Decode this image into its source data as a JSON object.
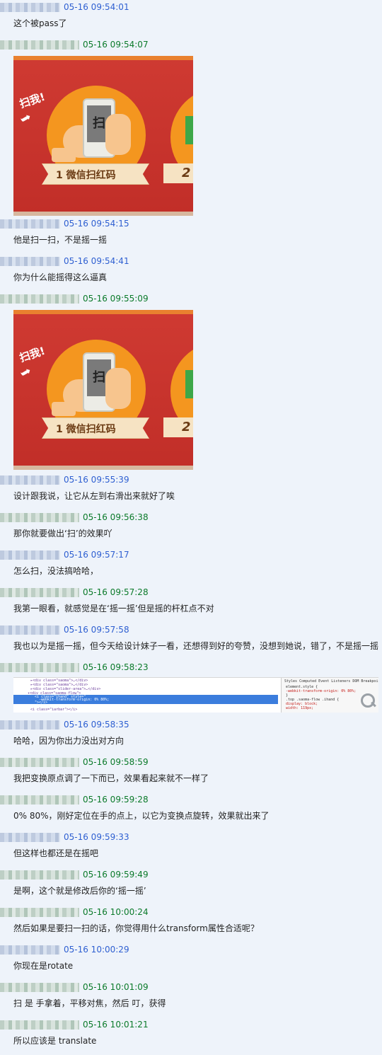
{
  "messages": [
    {
      "time": "05-16 09:54:01",
      "side": "blue",
      "text": "这个被pass了"
    },
    {
      "time": "05-16 09:54:07",
      "side": "green",
      "image": "promo",
      "promo": {
        "scan": "扫我!",
        "screen": "扫",
        "step1": "1 微信扫红码",
        "step2": "2"
      }
    },
    {
      "time": "05-16 09:54:15",
      "side": "blue",
      "text": "他是扫一扫，不是摇一摇"
    },
    {
      "time": "05-16 09:54:41",
      "side": "blue",
      "text": "你为什么能摇得这么逼真"
    },
    {
      "time": "05-16 09:55:09",
      "side": "green",
      "image": "promo",
      "promo": {
        "scan": "扫我!",
        "screen": "扫",
        "step1": "1 微信扫红码",
        "step2": "2"
      }
    },
    {
      "time": "05-16 09:55:39",
      "side": "blue",
      "text": "设计跟我说，让它从左到右滑出来就好了唉"
    },
    {
      "time": "05-16 09:56:38",
      "side": "green",
      "text": "那你就要做出‘扫’的效果吖"
    },
    {
      "time": "05-16 09:57:17",
      "side": "blue",
      "text": "怎么扫，没法搞哈哈，"
    },
    {
      "time": "05-16 09:57:28",
      "side": "green",
      "text": "我第一眼看，就感觉是在‘摇一摇’但是摇的杆杠点不对"
    },
    {
      "time": "05-16 09:57:58",
      "side": "blue",
      "text": "我也以为是摇一摇，但今天给设计妹子一看，还想得到好的夸赞，没想到她说，错了，不是摇一摇"
    },
    {
      "time": "05-16 09:58:23",
      "side": "green",
      "image": "devtools",
      "devtools": {
        "lines": [
          "▸<div class=\"saoma\">…</div>",
          "▸<div class=\"saoma\">…</div>",
          "▸<div class=\"slider-area\">…</div>",
          "▾<div class=\"saoma-flow\">"
        ],
        "selected": [
          "<i class=\"ihand\" style=\"",
          "-webkit-transform-origin: 0% 80%;",
          "\"></i>"
        ],
        "after": "<i class=\"iarbar\"></i>",
        "tabs": "Styles  Computed  Event Listeners  DOM Breakpoints  Pro",
        "rules": [
          "element.style {",
          "-webkit-transform-origin: 0% 80%;",
          "}",
          ".top .saoma-flow .ihand {",
          "display: block;",
          "width: 119px;"
        ]
      }
    },
    {
      "time": "05-16 09:58:35",
      "side": "blue",
      "text": "哈哈，因为你出力没出对方向"
    },
    {
      "time": "05-16 09:58:59",
      "side": "green",
      "text": "我把变换原点调了一下而已，效果看起来就不一样了"
    },
    {
      "time": "05-16 09:59:28",
      "side": "green",
      "text": "0% 80%，刚好定位在手的点上，以它为变换点旋转，效果就出来了"
    },
    {
      "time": "05-16 09:59:33",
      "side": "blue",
      "text": "但这样也都还是在摇吧"
    },
    {
      "time": "05-16 09:59:49",
      "side": "green",
      "text": "是啊，这个就是修改后你的‘摇一摇’"
    },
    {
      "time": "05-16 10:00:24",
      "side": "green",
      "text": "然后如果是要扫一扫的话，你觉得用什么transform属性合适呢？"
    },
    {
      "time": "05-16 10:00:29",
      "side": "blue",
      "text": "你现在是rotate"
    },
    {
      "time": "05-16 10:01:09",
      "side": "green",
      "text": "扫 是 手拿着，平移对焦，然后 叮，获得"
    },
    {
      "time": "05-16 10:01:21",
      "side": "green",
      "text": "所以应该是 translate"
    }
  ]
}
